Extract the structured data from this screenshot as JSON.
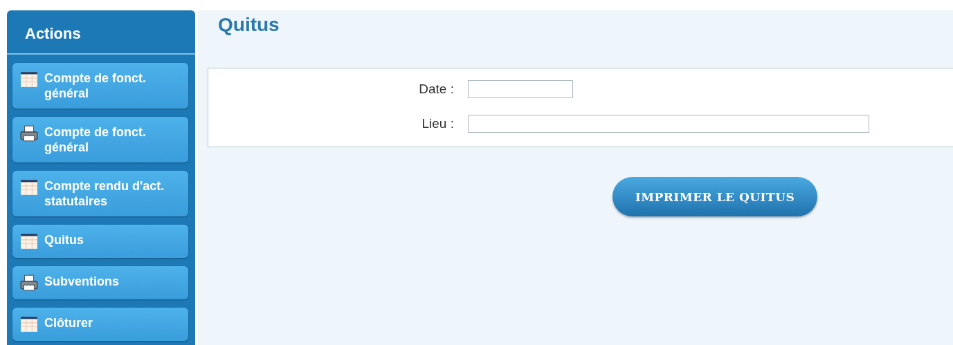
{
  "sidebar": {
    "title": "Actions",
    "items": [
      {
        "label": "Compte de fonct. général",
        "kind": "table"
      },
      {
        "label": "Compte de fonct. général",
        "kind": "printer"
      },
      {
        "label": "Compte rendu d'act. statutaires",
        "kind": "table"
      },
      {
        "label": "Quitus",
        "kind": "table"
      },
      {
        "label": "Subventions",
        "kind": "printer"
      },
      {
        "label": "Clôturer",
        "kind": "table"
      }
    ]
  },
  "page": {
    "title": "Quitus",
    "fields": [
      {
        "label": "Date :"
      },
      {
        "label": "Lieu :"
      }
    ],
    "button": "IMPRIMER LE QUITUS"
  }
}
